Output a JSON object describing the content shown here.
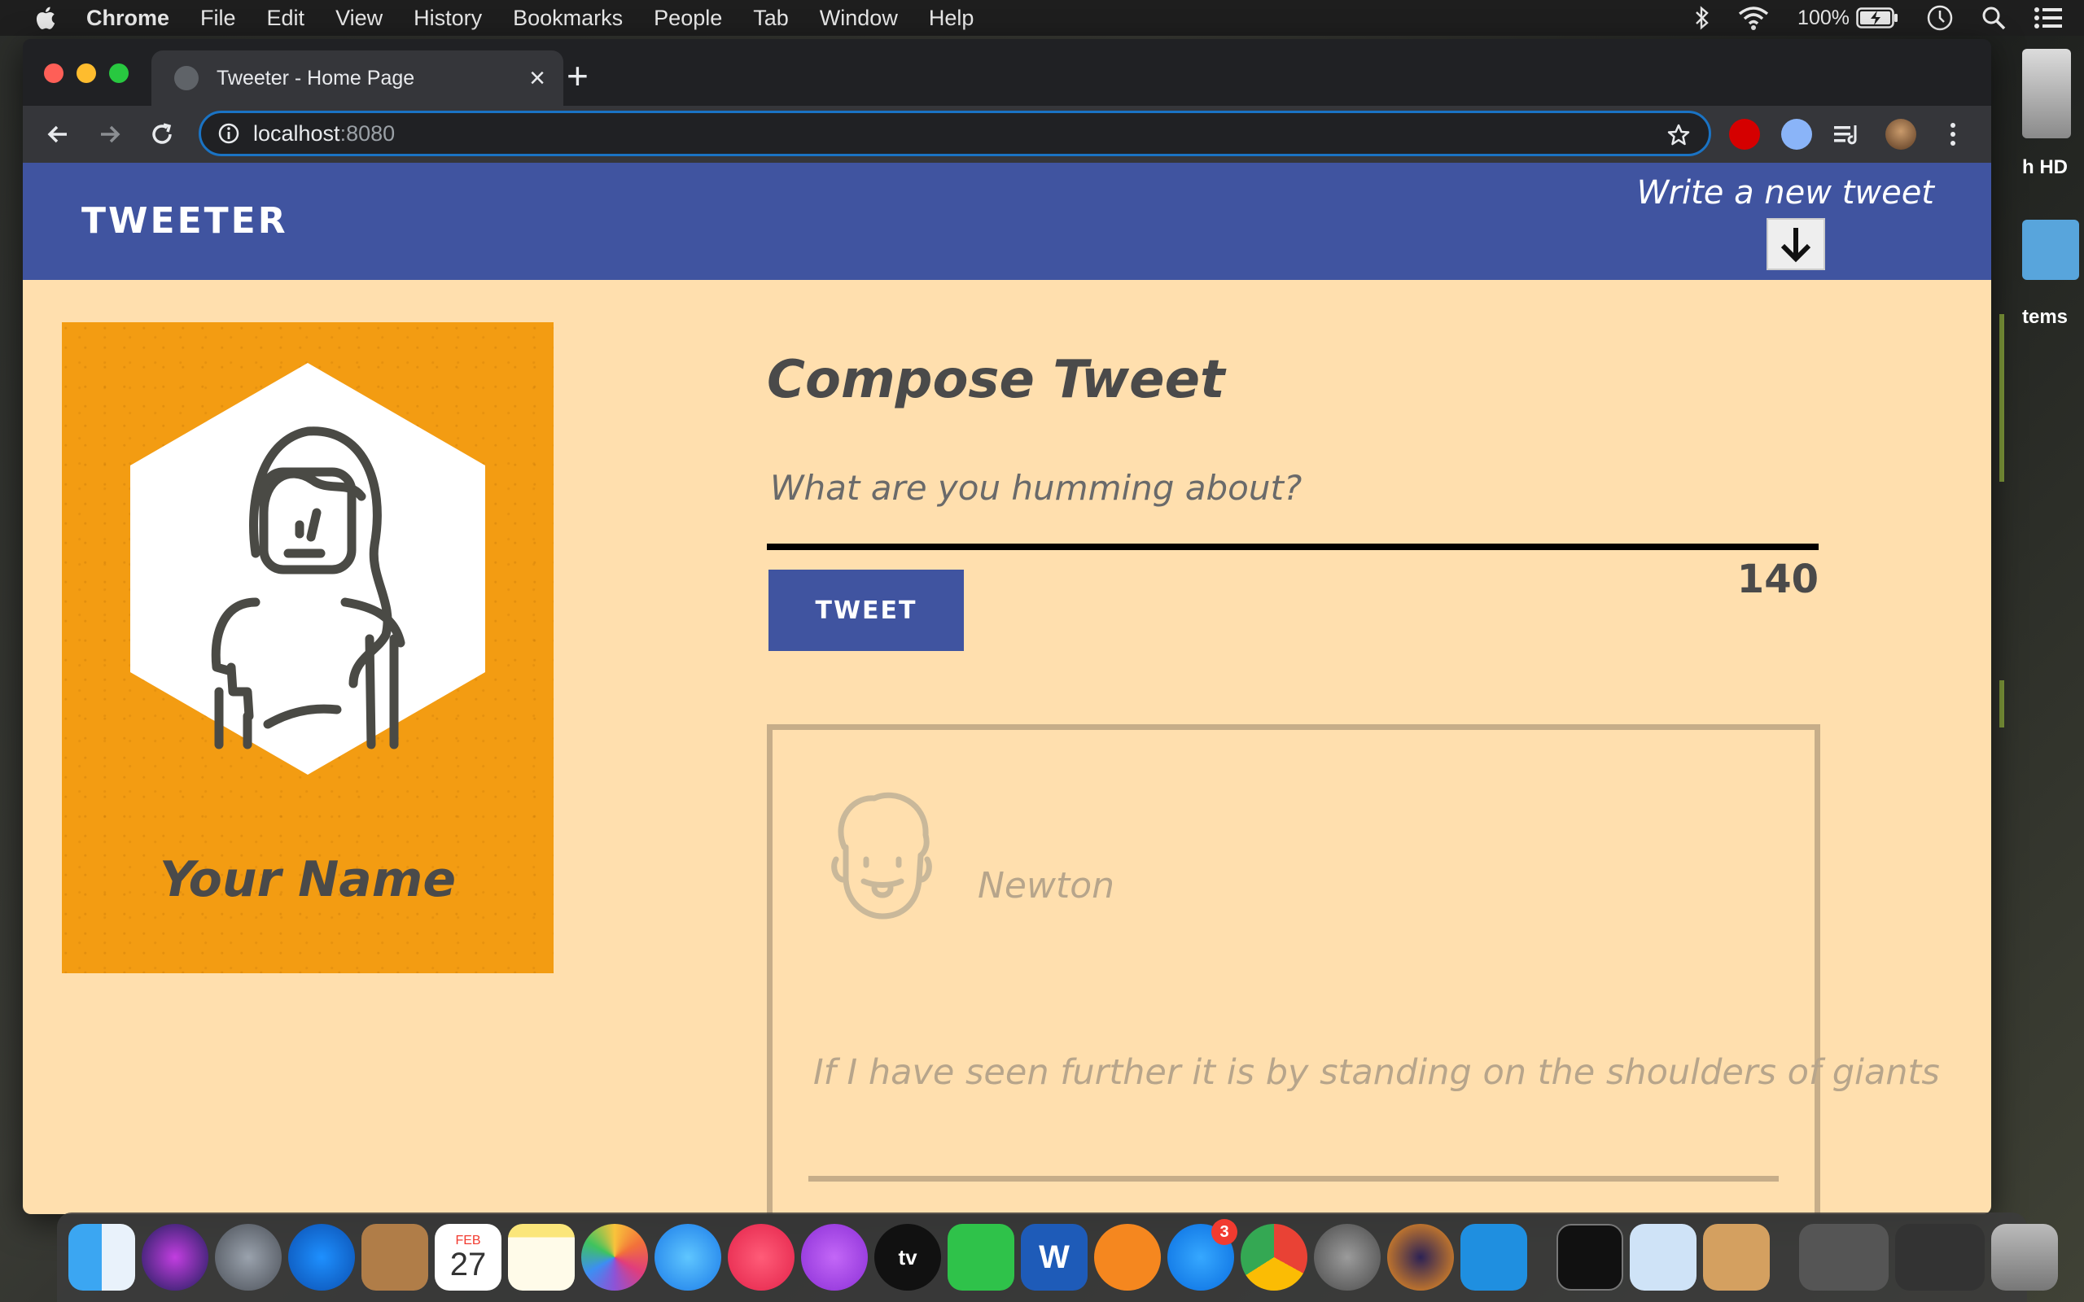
{
  "menubar": {
    "app_name": "Chrome",
    "items": [
      "File",
      "Edit",
      "View",
      "History",
      "Bookmarks",
      "People",
      "Tab",
      "Window",
      "Help"
    ],
    "battery": "100%"
  },
  "desktop": {
    "drive_label": "h HD",
    "folder_label": "tems"
  },
  "browser": {
    "tab_title": "Tweeter - Home Page",
    "url_host": "localhost",
    "url_port": ":8080"
  },
  "page": {
    "brand": "TWEETER",
    "write_new": "Write a new tweet",
    "profile_name": "Your Name",
    "compose_title": "Compose Tweet",
    "tweet_placeholder": "What are you humming about?",
    "tweet_button": "TWEET",
    "counter": "140",
    "tweet": {
      "author": "Newton",
      "content": "If I have seen further it is by standing on the shoulders of giants"
    }
  },
  "dock": {
    "calendar_month": "FEB",
    "calendar_day": "27",
    "appstore_badge": "3",
    "tv_label": "tv",
    "word_label": "W"
  }
}
